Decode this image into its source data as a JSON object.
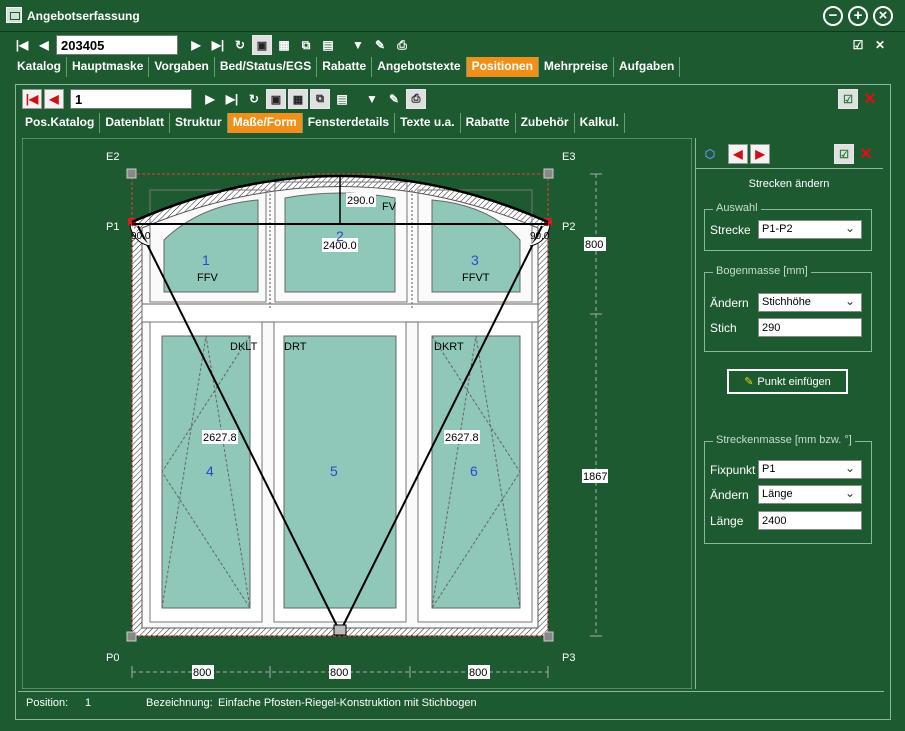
{
  "window": {
    "title": "Angebotserfassung"
  },
  "top_toolbar": {
    "record_number": "203405"
  },
  "main_tabs": [
    {
      "label": "Katalog",
      "active": false
    },
    {
      "label": "Hauptmaske",
      "active": false
    },
    {
      "label": "Vorgaben",
      "active": false
    },
    {
      "label": "Bed/Status/EGS",
      "active": false
    },
    {
      "label": "Rabatte",
      "active": false
    },
    {
      "label": "Angebotstexte",
      "active": false
    },
    {
      "label": "Positionen",
      "active": true
    },
    {
      "label": "Mehrpreise",
      "active": false
    },
    {
      "label": "Aufgaben",
      "active": false
    }
  ],
  "sub_toolbar": {
    "position_number": "1"
  },
  "sub_tabs": [
    {
      "label": "Pos.Katalog",
      "active": false
    },
    {
      "label": "Datenblatt",
      "active": false
    },
    {
      "label": "Struktur",
      "active": false
    },
    {
      "label": "Maße/Form",
      "active": true
    },
    {
      "label": "Fensterdetails",
      "active": false
    },
    {
      "label": "Texte u.a.",
      "active": false
    },
    {
      "label": "Rabatte",
      "active": false
    },
    {
      "label": "Zubehör",
      "active": false
    },
    {
      "label": "Kalkul.",
      "active": false
    }
  ],
  "drawing": {
    "corner_labels": {
      "e2": "E2",
      "e3": "E3",
      "p1": "P1",
      "p2": "P2",
      "p0": "P0",
      "p3": "P3"
    },
    "arc_height": "290.0",
    "chord_length": "2400.0",
    "angle_left": "90.0",
    "angle_right": "90.0",
    "diag_left": "2627.8",
    "diag_right": "2627.8",
    "fields": {
      "f1_num": "1",
      "f1_type": "FFV",
      "f2_num": "2",
      "f2_type": "FV",
      "f3_num": "3",
      "f3_type": "FFVT",
      "f4_num": "4",
      "f4_type": "DKLT",
      "f5_num": "5",
      "f5_type": "DRT",
      "f6_num": "6",
      "f6_type": "DKRT"
    },
    "dims": {
      "right_top": "800",
      "right_main": "1867",
      "bottom_1": "800",
      "bottom_2": "800",
      "bottom_3": "800"
    }
  },
  "right_panel": {
    "title": "Strecken ändern",
    "auswahl": {
      "group": "Auswahl",
      "strecke_label": "Strecke",
      "strecke_value": "P1-P2"
    },
    "bogen": {
      "group": "Bogenmasse [mm]",
      "aendern_label": "Ändern",
      "aendern_value": "Stichhöhe",
      "stich_label": "Stich",
      "stich_value": "290"
    },
    "punkt_button": "Punkt einfügen",
    "strecken": {
      "group": "Streckenmasse [mm bzw. °]",
      "fixpunkt_label": "Fixpunkt",
      "fixpunkt_value": "P1",
      "aendern_label": "Ändern",
      "aendern_value": "Länge",
      "laenge_label": "Länge",
      "laenge_value": "2400"
    }
  },
  "status": {
    "position_label": "Position:",
    "position_value": "1",
    "bezeichnung_label": "Bezeichnung:",
    "bezeichnung_value": "Einfache Pfosten-Riegel-Konstruktion mit Stichbogen"
  }
}
